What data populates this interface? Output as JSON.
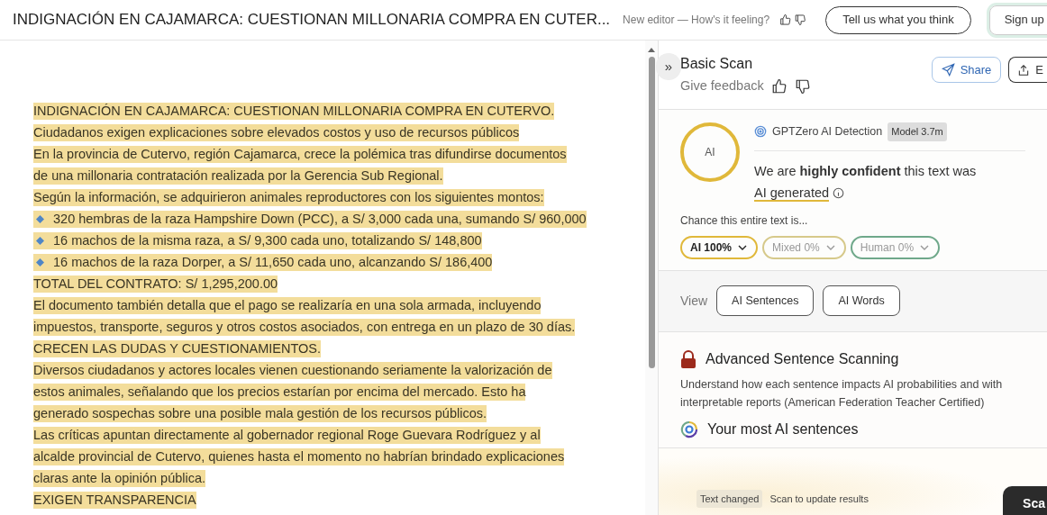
{
  "header": {
    "title": "INDIGNACIÓN EN CAJAMARCA: CUESTIONAN MILLONARIA COMPRA EN CUTER...",
    "feedback_prompt": "New editor — How's it feeling?",
    "tell_button": "Tell us what you think",
    "signup_button": "Sign up"
  },
  "editor": {
    "lines": [
      {
        "kind": "text",
        "text": "INDIGNACIÓN EN CAJAMARCA: CUESTIONAN MILLONARIA COMPRA EN CUTERVO."
      },
      {
        "kind": "text",
        "text": "Ciudadanos exigen explicaciones sobre elevados costos y uso de recursos públicos"
      },
      {
        "kind": "text",
        "text": "En la provincia de Cutervo, región Cajamarca, crece la polémica tras difundirse documentos"
      },
      {
        "kind": "text",
        "text": "de una millonaria contratación realizada por la Gerencia Sub Regional."
      },
      {
        "kind": "text",
        "text": "Según la información, se adquirieron animales reproductores con los siguientes montos:"
      },
      {
        "kind": "bullet",
        "text": "320 hembras de la raza Hampshire Down (PCC), a S/ 3,000 cada una, sumando S/ 960,000"
      },
      {
        "kind": "bullet",
        "text": "16 machos de la misma raza, a S/ 9,300 cada uno, totalizando S/ 148,800"
      },
      {
        "kind": "bullet",
        "text": "16 machos de la raza Dorper, a S/ 11,650 cada uno, alcanzando S/ 186,400"
      },
      {
        "kind": "text",
        "text": "TOTAL DEL CONTRATO: S/ 1,295,200.00"
      },
      {
        "kind": "text",
        "text": "El documento también detalla que el pago se realizaría en una sola armada, incluyendo"
      },
      {
        "kind": "text",
        "text": "impuestos, transporte, seguros y otros costos asociados, con entrega en un plazo de 30 días."
      },
      {
        "kind": "text",
        "text": "CRECEN LAS DUDAS Y CUESTIONAMIENTOS."
      },
      {
        "kind": "text",
        "text": "Diversos ciudadanos y actores locales vienen cuestionando seriamente la valorización de"
      },
      {
        "kind": "text",
        "text": "estos animales, señalando que los precios estarían por encima del mercado. Esto ha"
      },
      {
        "kind": "text",
        "text": "generado sospechas sobre una posible mala gestión de los recursos públicos."
      },
      {
        "kind": "text",
        "text": "Las críticas apuntan directamente al gobernador regional Roge Guevara Rodríguez y al"
      },
      {
        "kind": "text",
        "text": "alcalde provincial de Cutervo, quienes hasta el momento no habrían brindado explicaciones"
      },
      {
        "kind": "text",
        "text": "claras ante la opinión pública."
      },
      {
        "kind": "text",
        "text": "EXIGEN TRANSPARENCIA"
      }
    ]
  },
  "panel": {
    "collapse": "»",
    "title": "Basic Scan",
    "feedback": "Give feedback",
    "share": "Share",
    "export": "E",
    "detector": "GPTZero AI Detection",
    "model": "Model 3.7m",
    "circle_label": "AI",
    "verdict": "We are **highly confident** this text was",
    "verdict_highlight": "AI generated",
    "chance_label": "Chance this entire text is...",
    "chips": [
      {
        "label": "AI 100%",
        "color": "#e0b83a",
        "selected": true
      },
      {
        "label": "Mixed 0%",
        "color": "#d6c98a",
        "selected": false
      },
      {
        "label": "Human 0%",
        "color": "#6fa88a",
        "selected": false
      }
    ],
    "view_label": "View",
    "view_buttons": [
      "AI Sentences",
      "AI Words"
    ],
    "advanced_title": "Advanced Sentence Scanning",
    "advanced_text": "Understand how each sentence impacts AI probabilities and with interpretable reports (American Federation Teacher Certified)",
    "most_title": "Your most AI sentences",
    "notice_badge": "Text changed",
    "notice_text": "Scan to update results",
    "scan_button": "Sca"
  }
}
